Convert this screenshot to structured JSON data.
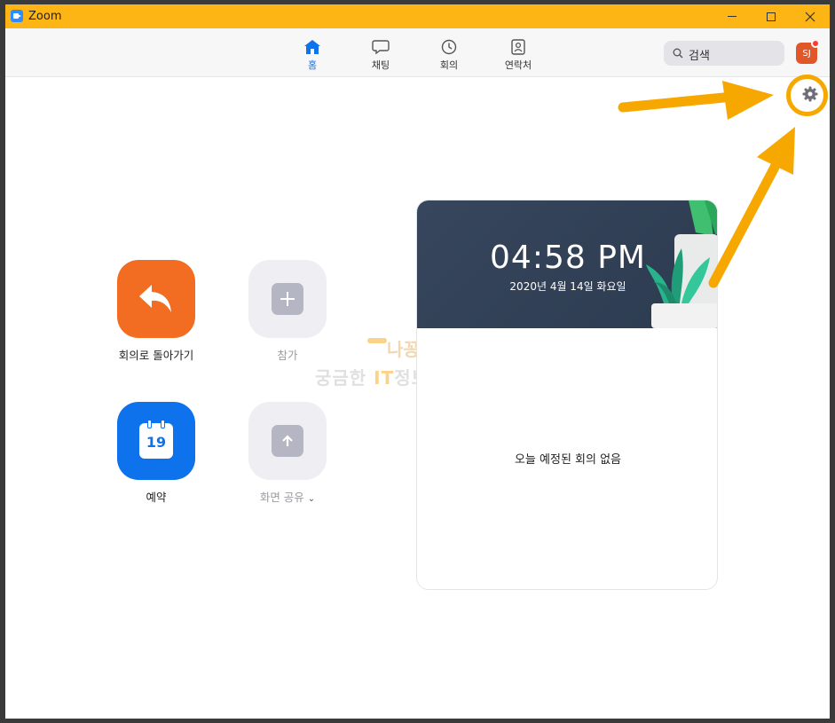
{
  "window": {
    "title": "Zoom"
  },
  "nav": {
    "tabs": [
      {
        "label": "홈",
        "icon": "home-icon",
        "active": true
      },
      {
        "label": "채팅",
        "icon": "chat-icon",
        "active": false
      },
      {
        "label": "회의",
        "icon": "clock-icon",
        "active": false
      },
      {
        "label": "연락처",
        "icon": "contacts-icon",
        "active": false
      }
    ],
    "search_label": "검색",
    "avatar_initials": "SJ"
  },
  "actions": {
    "rejoin": "회의로 돌아가기",
    "join": "참가",
    "schedule": "예약",
    "schedule_day": "19",
    "share": "화면 공유",
    "share_chevron": "⌄"
  },
  "watermark": {
    "line1": "나꽁이의",
    "line2_a": "궁금한 ",
    "line2_it": "IT",
    "line2_b": "정보저장소"
  },
  "meeting_card": {
    "time": "04:58 PM",
    "date": "2020년 4월 14일 화요일",
    "empty_message": "오늘 예정된 회의 없음"
  },
  "colors": {
    "title_bar": "#fdb515",
    "accent_blue": "#0e72ed",
    "rejoin_orange": "#f26d21",
    "annotation_arrow": "#f7a800"
  }
}
